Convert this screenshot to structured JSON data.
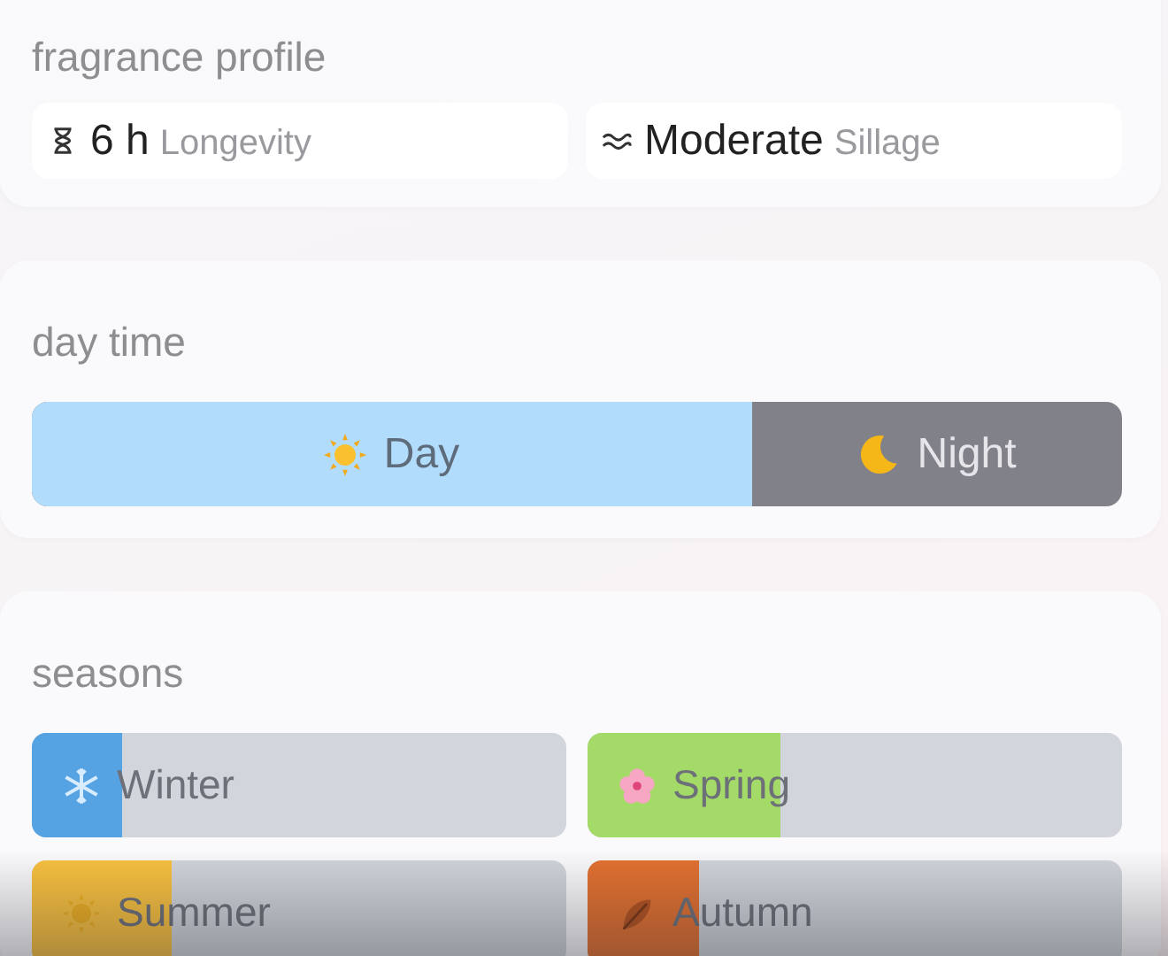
{
  "fragrance_profile": {
    "title": "fragrance profile",
    "stats": [
      {
        "kind": "longevity",
        "value": "6 h",
        "label": "Longevity"
      },
      {
        "kind": "sillage",
        "value": "Moderate",
        "label": "Sillage"
      }
    ]
  },
  "day_time": {
    "title": "day time",
    "level": 0.66,
    "segments": [
      {
        "kind": "day",
        "label": "Day"
      },
      {
        "kind": "night",
        "label": "Night"
      }
    ]
  },
  "seasons": {
    "title": "seasons",
    "items": [
      {
        "kind": "winter",
        "label": "Winter",
        "level": 0.17,
        "color": "#55a3e3"
      },
      {
        "kind": "spring",
        "label": "Spring",
        "level": 0.36,
        "color": "#a3da68"
      },
      {
        "kind": "summer",
        "label": "Summer",
        "level": 0.26,
        "color": "#f9c13e"
      },
      {
        "kind": "autumn",
        "label": "Autumn",
        "level": 0.21,
        "color": "#e3702f"
      }
    ]
  }
}
